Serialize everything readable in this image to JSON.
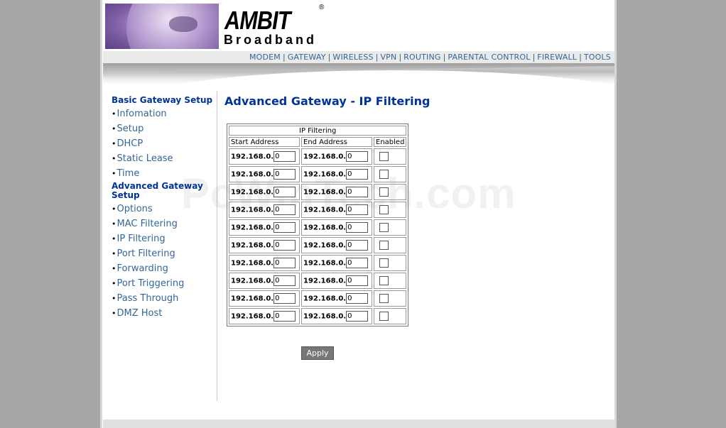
{
  "brand": {
    "logo_text": "AMBIT",
    "reg_mark": "®",
    "subtitle": "Broadband",
    "watermark": "PcWinTech.com"
  },
  "nav": {
    "items": [
      {
        "label": "MODEM"
      },
      {
        "label": "GATEWAY"
      },
      {
        "label": "WIRELESS"
      },
      {
        "label": "VPN"
      },
      {
        "label": "ROUTING"
      },
      {
        "label": "PARENTAL CONTROL"
      },
      {
        "label": "FIREWALL"
      },
      {
        "label": "TOOLS"
      }
    ],
    "separator": "|",
    "link_color": "#336699"
  },
  "sidebar": {
    "basic_heading": "Basic Gateway Setup",
    "basic_items": [
      {
        "label": "Infomation"
      },
      {
        "label": "Setup"
      },
      {
        "label": "DHCP"
      },
      {
        "label": "Static Lease"
      },
      {
        "label": "Time"
      }
    ],
    "advanced_heading_line1": "Advanced Gateway",
    "advanced_heading_line2": "Setup",
    "advanced_items": [
      {
        "label": "Options"
      },
      {
        "label": "MAC Filtering"
      },
      {
        "label": "IP Filtering"
      },
      {
        "label": "Port Filtering"
      },
      {
        "label": "Forwarding"
      },
      {
        "label": "Port Triggering"
      },
      {
        "label": "Pass Through"
      },
      {
        "label": "DMZ Host"
      }
    ],
    "bullet": "•"
  },
  "main": {
    "title": "Advanced Gateway - IP Filtering",
    "table": {
      "caption": "IP Filtering",
      "col_start": "Start Address",
      "col_end": "End Address",
      "col_enabled": "Enabled",
      "prefix": "192.168.0.",
      "rows": [
        {
          "start": "0",
          "end": "0",
          "enabled": false
        },
        {
          "start": "0",
          "end": "0",
          "enabled": false
        },
        {
          "start": "0",
          "end": "0",
          "enabled": false
        },
        {
          "start": "0",
          "end": "0",
          "enabled": false
        },
        {
          "start": "0",
          "end": "0",
          "enabled": false
        },
        {
          "start": "0",
          "end": "0",
          "enabled": false
        },
        {
          "start": "0",
          "end": "0",
          "enabled": false
        },
        {
          "start": "0",
          "end": "0",
          "enabled": false
        },
        {
          "start": "0",
          "end": "0",
          "enabled": false
        },
        {
          "start": "0",
          "end": "0",
          "enabled": false
        }
      ]
    },
    "apply_label": "Apply"
  },
  "colors": {
    "heading": "#003399",
    "link": "#336699",
    "background_gutter": "#a7a7a7"
  }
}
